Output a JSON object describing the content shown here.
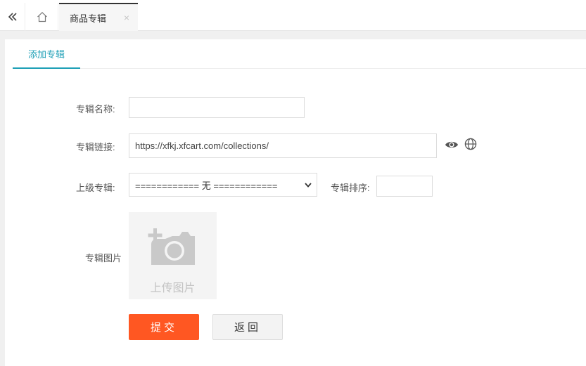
{
  "topbar": {
    "collapse_icon": "double-chevron-left-icon",
    "home_icon": "home-icon",
    "tab_label": "商品专辑",
    "close_symbol": "×"
  },
  "subtabs": {
    "active_label": "添加专辑"
  },
  "form": {
    "name_label": "专辑名称:",
    "name_value": "",
    "link_label": "专辑链接:",
    "link_value": "https://xfkj.xfcart.com/collections/",
    "preview_icon": "eye-icon",
    "open_icon": "globe-icon",
    "parent_label": "上级专辑:",
    "parent_selected": "============ 无 ============",
    "sort_label": "专辑排序:",
    "sort_value": "",
    "image_label": "专辑图片",
    "upload_text": "上传图片",
    "upload_icon": "add-camera-icon"
  },
  "actions": {
    "submit_label": "提交",
    "back_label": "返回"
  },
  "colors": {
    "accent": "#1e9fb6",
    "submit": "#ff5722"
  }
}
